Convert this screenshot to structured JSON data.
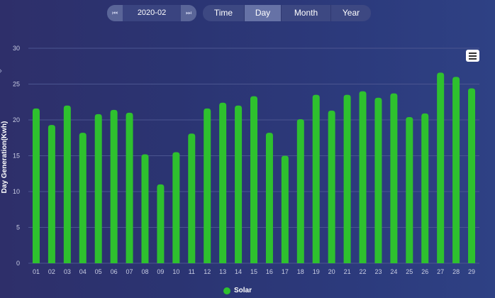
{
  "date_nav": {
    "value": "2020-02",
    "prev_icon": "skip-previous-icon",
    "next_icon": "skip-next-icon"
  },
  "tabs": [
    {
      "label": "Time",
      "active": false
    },
    {
      "label": "Day",
      "active": true
    },
    {
      "label": "Month",
      "active": false
    },
    {
      "label": "Year",
      "active": false
    }
  ],
  "menu_icon": "hamburger-menu-icon",
  "colors": {
    "bar": "#2ec12e",
    "grid": "#4b5590",
    "tick_text": "#c9cde3",
    "axis_title": "#ffffff"
  },
  "chart_data": {
    "type": "bar",
    "ylabel": "Day Generation(Kwh)",
    "xlabel": "",
    "ylim": [
      0,
      30
    ],
    "yticks": [
      0,
      5,
      10,
      15,
      20,
      25,
      30
    ],
    "grid": true,
    "legend_position": "bottom-center",
    "categories": [
      "01",
      "02",
      "03",
      "04",
      "05",
      "06",
      "07",
      "08",
      "09",
      "10",
      "11",
      "12",
      "13",
      "14",
      "15",
      "16",
      "17",
      "18",
      "19",
      "20",
      "21",
      "22",
      "23",
      "24",
      "25",
      "26",
      "27",
      "28",
      "29"
    ],
    "series": [
      {
        "name": "Solar",
        "values": [
          21.6,
          19.3,
          22.0,
          18.2,
          20.8,
          21.4,
          21.0,
          15.2,
          11.0,
          15.5,
          18.1,
          21.6,
          22.4,
          22.0,
          23.3,
          18.2,
          15.0,
          20.1,
          23.5,
          21.3,
          23.5,
          24.0,
          23.1,
          23.7,
          20.4,
          20.9,
          26.6,
          26.0,
          24.4
        ]
      }
    ]
  }
}
